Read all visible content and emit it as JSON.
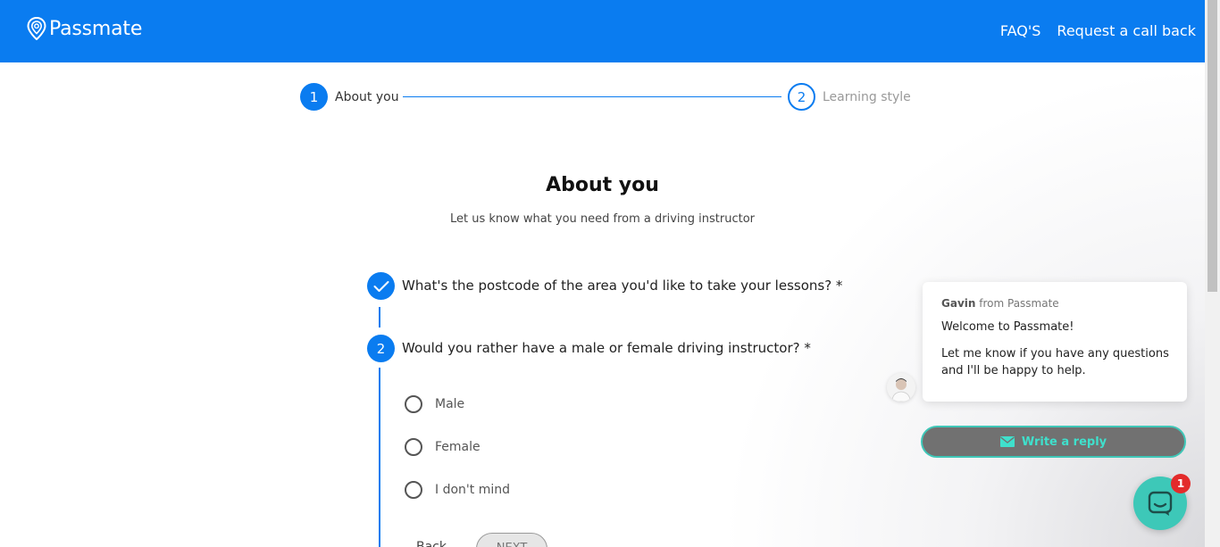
{
  "header": {
    "logo_text": "Passmate",
    "nav": {
      "faq": "FAQ'S",
      "callback": "Request a call back"
    }
  },
  "stepper": {
    "steps": [
      {
        "number": "1",
        "label": "About you",
        "state": "active"
      },
      {
        "number": "2",
        "label": "Learning style",
        "state": "upcoming"
      }
    ]
  },
  "main": {
    "title": "About you",
    "subtitle": "Let us know what you need from a driving instructor",
    "questions": [
      {
        "number": "1",
        "status": "completed",
        "text": "What's the postcode of the area you'd like to take your lessons? *"
      },
      {
        "number": "2",
        "status": "current",
        "text": "Would you rather have a male or female driving instructor? *"
      }
    ],
    "options": [
      "Male",
      "Female",
      "I don't mind"
    ],
    "back_label": "Back",
    "next_label": "NEXT"
  },
  "chat": {
    "agent_name": "Gavin",
    "from_text": "from Passmate",
    "welcome": "Welcome to Passmate!",
    "body": "Let me know if you have any questions and I'll be happy to help.",
    "reply_label": "Write a reply",
    "unread_count": "1"
  },
  "colors": {
    "brand_blue": "#0a7cf0",
    "chat_teal": "#3dc8b8",
    "badge_red": "#e32b2b"
  }
}
